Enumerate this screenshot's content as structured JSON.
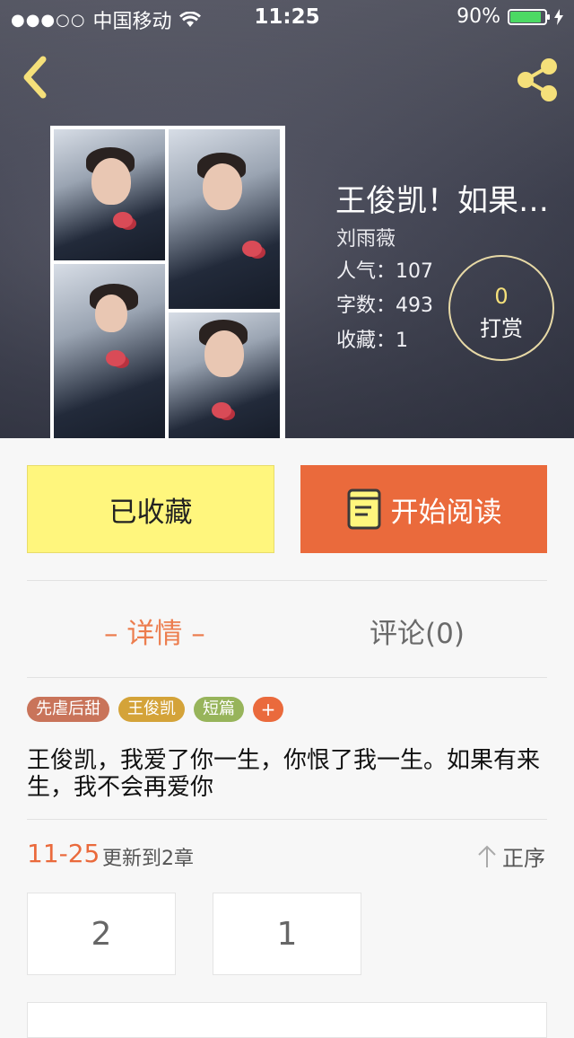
{
  "status_bar": {
    "signal": "●●●○○",
    "carrier": "中国移动",
    "time": "11:25",
    "battery_percent": "90%",
    "battery_level": 0.9
  },
  "header": {
    "back_icon": "chevron-left-icon",
    "share_icon": "share-icon"
  },
  "book": {
    "title": "王俊凯！如果…",
    "author": "刘雨薇",
    "popularity": "人气：107",
    "word_count": "字数：493",
    "favorites": "收藏：1"
  },
  "tip": {
    "count": "0",
    "label": "打赏"
  },
  "actions": {
    "favorite_label": "已收藏",
    "read_label": "开始阅读"
  },
  "tabs": {
    "detail": "– 详情 –",
    "comments": "评论(0)"
  },
  "tags": [
    {
      "label": "先虐后甜",
      "color": "#c9745a"
    },
    {
      "label": "王俊凯",
      "color": "#d4a339"
    },
    {
      "label": "短篇",
      "color": "#97b45b"
    }
  ],
  "tag_add": "+",
  "description": "王俊凯，我爱了你一生，你恨了我一生。如果有来生，我不会再爱你",
  "update": {
    "date": "11-25",
    "text": "更新到2章",
    "sort_label": "正序"
  },
  "chapters": [
    "2",
    "1"
  ],
  "colors": {
    "accent_orange": "#ea6a3c",
    "favorite_yellow": "#fff67d",
    "tip_yellow": "#f5e07a"
  }
}
